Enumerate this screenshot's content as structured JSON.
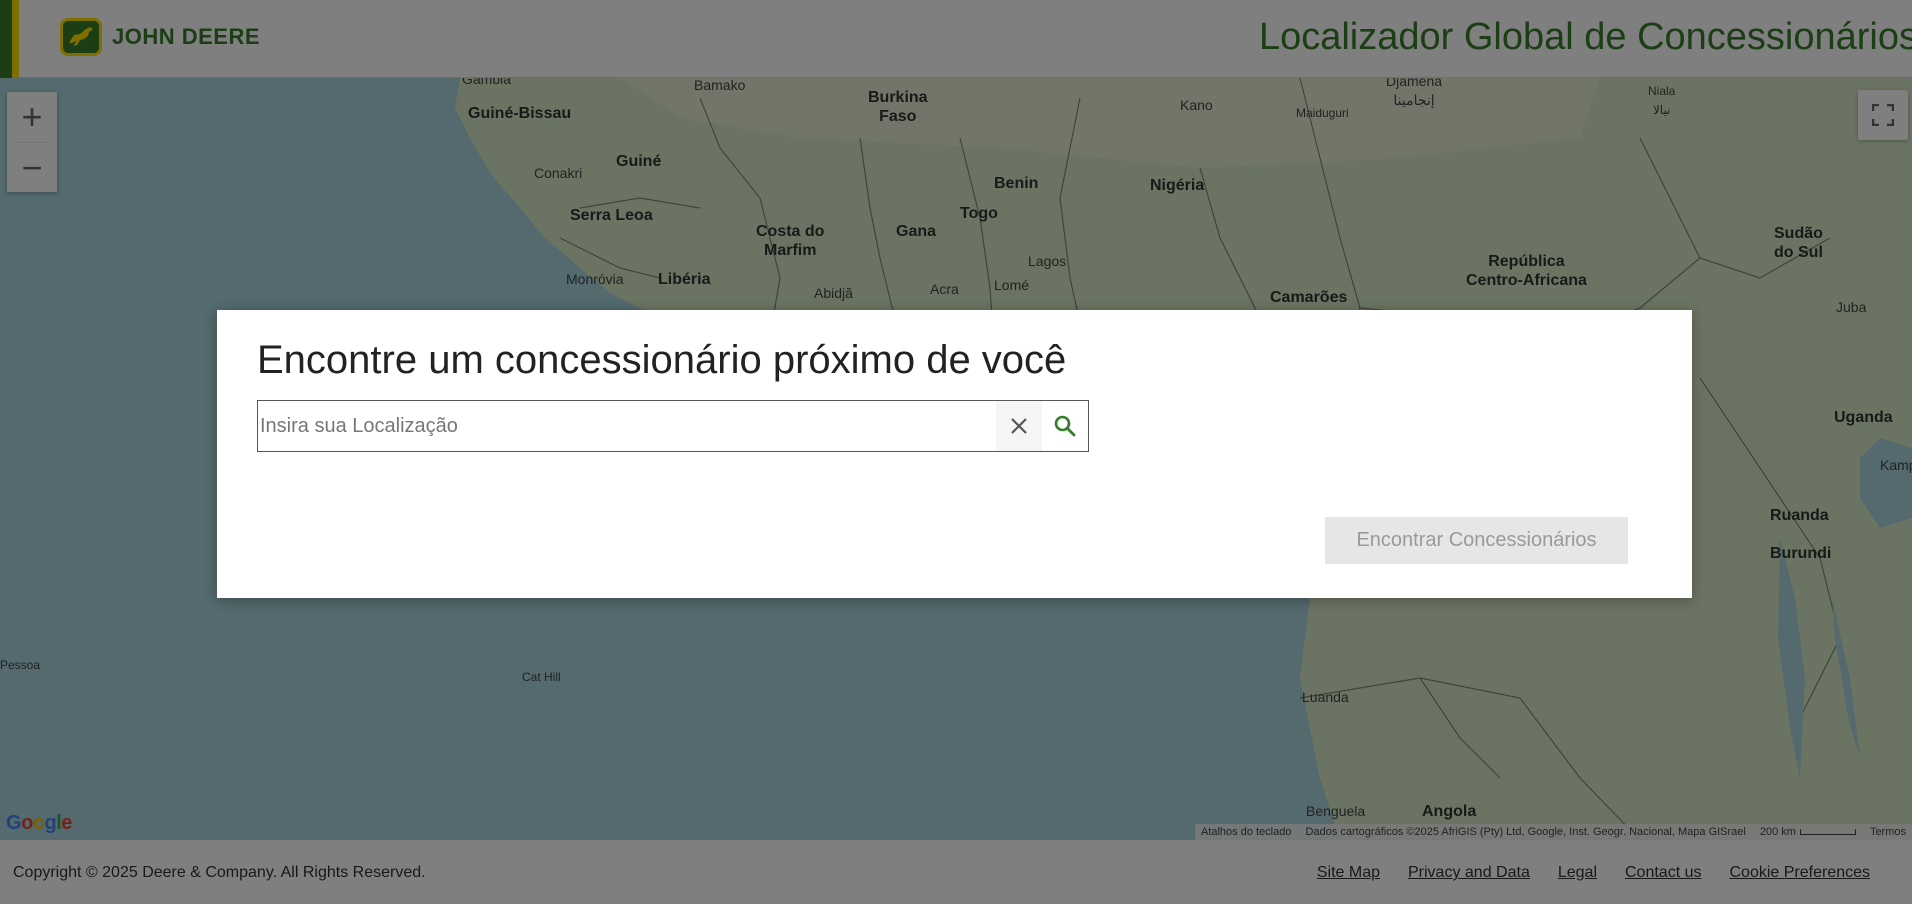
{
  "header": {
    "brand": "JOHN DEERE",
    "logo_icon": "deer-logo-icon",
    "title": "Localizador Global de Concessionários",
    "colors": {
      "brand_green": "#367c2b",
      "brand_yellow": "#ffde00"
    }
  },
  "map": {
    "zoom_in_label": "+",
    "zoom_out_label": "−",
    "fullscreen_icon": "fullscreen-icon",
    "labels": {
      "gambia": "Gâmbia",
      "bamako": "Bamako",
      "burkina": "Burkina\nFaso",
      "kano": "Kano",
      "ndjamena": "Djamena\nإنجامينا",
      "niala": "Niala\nنيالا",
      "maiduguri": "Maiduguri",
      "guine_bissau": "Guiné-Bissau",
      "conakri": "Conakri",
      "guine": "Guiné",
      "benin": "Benin",
      "nigeria": "Nigéria",
      "serra_leoa": "Serra Leoa",
      "costa_marfim": "Costa do\nMarfim",
      "gana": "Gana",
      "togo": "Togo",
      "sudao_sul": "Sudão\ndo Sul",
      "monrovia": "Monróvia",
      "liberia": "Libéria",
      "abidja": "Abidjã",
      "lagos": "Lagos",
      "acra": "Acra",
      "lome": "Lomé",
      "republica_ca": "República\nCentro-Africana",
      "camaroes": "Camarões",
      "juba": "Juba",
      "uganda": "Uganda",
      "kampala": "Kampala",
      "ruanda": "Ruanda",
      "burundi": "Burundi",
      "pessoa": "Pessoa",
      "cat_hill": "Cat Hill",
      "luanda": "Luanda",
      "benguela": "Benguela",
      "angola": "Angola"
    },
    "google_logo": "Google",
    "keyboard_shortcuts": "Atalhos do teclado",
    "map_data": "Dados cartográficos ©2025 AfriGIS (Pty) Ltd, Google, Inst. Geogr. Nacional, Mapa GISrael",
    "scale": "200 km",
    "terms": "Termos"
  },
  "modal": {
    "title": "Encontre um concessionário próximo de você",
    "search_placeholder": "Insira sua Localização",
    "search_value": "",
    "clear_icon": "close-icon",
    "search_icon": "search-icon",
    "find_button": "Encontrar Concessionários"
  },
  "footer": {
    "copyright": "Copyright © 2025 Deere & Company. All Rights Reserved.",
    "links": [
      "Site Map",
      "Privacy and Data",
      "Legal",
      "Contact us",
      "Cookie Preferences"
    ]
  }
}
